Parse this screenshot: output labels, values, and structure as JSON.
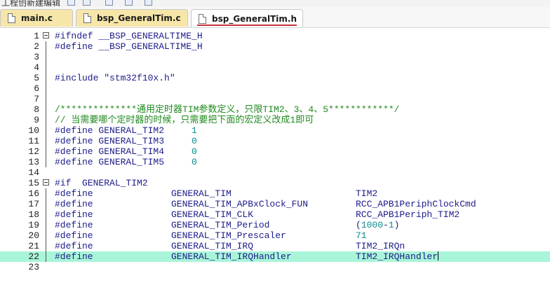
{
  "toolbar": {
    "partial_text": "工程创新建编辑"
  },
  "tabs": [
    {
      "label": "main.c",
      "active": false
    },
    {
      "label": "bsp_GeneralTim.c",
      "active": false
    },
    {
      "label": "bsp_GeneralTim.h",
      "active": true
    }
  ],
  "colors": {
    "tab_inactive": "#f6e6a9",
    "active_underline": "#c8323c",
    "highlight_line": "#a9f5d9",
    "keyword": "#1c1c8a",
    "number": "#0b8a8a",
    "comment": "#1f8a1f"
  },
  "lines": [
    {
      "n": "1",
      "fold": true,
      "tokens": [
        [
          "pp",
          "#ifndef __BSP_GENERALTIME_H"
        ]
      ]
    },
    {
      "n": "2",
      "tokens": [
        [
          "pp",
          "#define __BSP_GENERALTIME_H"
        ]
      ]
    },
    {
      "n": "3",
      "tokens": []
    },
    {
      "n": "4",
      "tokens": []
    },
    {
      "n": "5",
      "tokens": [
        [
          "pp",
          "#include "
        ],
        [
          "str",
          "\"stm32f10x.h\""
        ]
      ]
    },
    {
      "n": "6",
      "tokens": []
    },
    {
      "n": "7",
      "tokens": []
    },
    {
      "n": "8",
      "tokens": [
        [
          "com",
          "/**************通用定时器TIM参数定义，只限TIM2、3、4、5************/"
        ]
      ]
    },
    {
      "n": "9",
      "tokens": [
        [
          "com",
          "// 当需要哪个定时器的时候，只需要把下面的宏定义改成1即可"
        ]
      ]
    },
    {
      "n": "10",
      "tokens": [
        [
          "pp",
          "#define GENERAL_TIM2     "
        ],
        [
          "num",
          "1"
        ]
      ]
    },
    {
      "n": "11",
      "tokens": [
        [
          "pp",
          "#define GENERAL_TIM3     "
        ],
        [
          "num",
          "0"
        ]
      ]
    },
    {
      "n": "12",
      "tokens": [
        [
          "pp",
          "#define GENERAL_TIM4     "
        ],
        [
          "num",
          "0"
        ]
      ]
    },
    {
      "n": "13",
      "tokens": [
        [
          "pp",
          "#define GENERAL_TIM5     "
        ],
        [
          "num",
          "0"
        ]
      ]
    },
    {
      "n": "14",
      "tokens": []
    },
    {
      "n": "15",
      "fold": true,
      "tokens": [
        [
          "pp",
          "#if  GENERAL_TIM2"
        ]
      ]
    },
    {
      "n": "16",
      "cols": [
        "#define",
        "GENERAL_TIM",
        [
          [
            "plain",
            "TIM2"
          ]
        ]
      ]
    },
    {
      "n": "17",
      "cols": [
        "#define",
        "GENERAL_TIM_APBxClock_FUN",
        [
          [
            "plain",
            "RCC_APB1PeriphClockCmd"
          ]
        ]
      ]
    },
    {
      "n": "18",
      "cols": [
        "#define",
        "GENERAL_TIM_CLK",
        [
          [
            "plain",
            "RCC_APB1Periph_TIM2"
          ]
        ]
      ]
    },
    {
      "n": "19",
      "cols": [
        "#define",
        "GENERAL_TIM_Period",
        [
          [
            "plain",
            "("
          ],
          [
            "num",
            "1000"
          ],
          [
            "plain",
            "-"
          ],
          [
            "num",
            "1"
          ],
          [
            "plain",
            ")"
          ]
        ]
      ]
    },
    {
      "n": "20",
      "cols": [
        "#define",
        "GENERAL_TIM_Prescaler",
        [
          [
            "num",
            "71"
          ]
        ]
      ]
    },
    {
      "n": "21",
      "cols": [
        "#define",
        "GENERAL_TIM_IRQ",
        [
          [
            "plain",
            "TIM2_IRQn"
          ]
        ]
      ]
    },
    {
      "n": "22",
      "highlight": true,
      "cursor": true,
      "cols": [
        "#define",
        "GENERAL_TIM_IRQHandler",
        [
          [
            "plain",
            "TIM2_IRQHandler"
          ]
        ]
      ]
    },
    {
      "n": "23",
      "tokens": []
    }
  ]
}
